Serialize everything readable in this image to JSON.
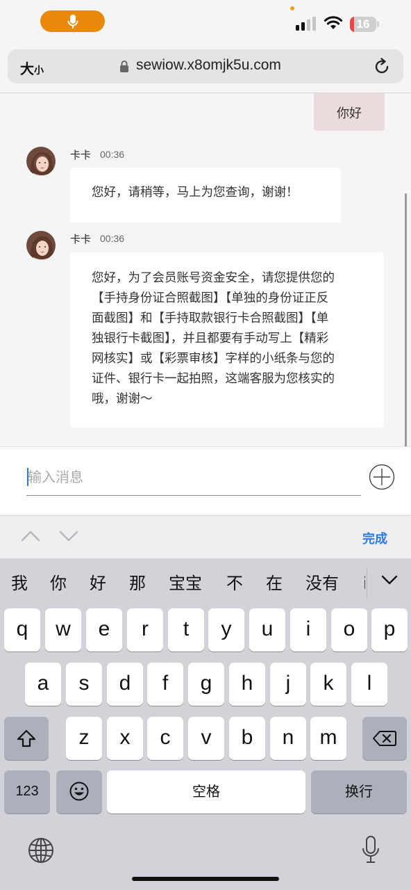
{
  "status_bar": {
    "battery_level": "16",
    "battery_fraction": 0.16,
    "icons": [
      "mic-icon",
      "signal-icon",
      "wifi-icon",
      "battery-icon"
    ],
    "colors": {
      "mic_pill": "#e8890c",
      "battery_fill": "#e8484a"
    }
  },
  "browser": {
    "text_size_label_big": "大",
    "text_size_label_small": "小",
    "url": "sewiow.x8omjk5u.com",
    "icons": [
      "lock-icon",
      "reload-icon"
    ]
  },
  "chat": {
    "my_message": "你好",
    "messages": [
      {
        "sender": "卡卡",
        "time": "00:36",
        "text": "您好，请稍等，马上为您查询，谢谢！"
      },
      {
        "sender": "卡卡",
        "time": "00:36",
        "lines": [
          "您好，为了会员账号资金安全，请您提供您的",
          "【手持身份证合照截图】【单独的身份证正反",
          "面截图】和【手持取款银行卡合照截图】【单",
          "独银行卡截图】，并且都要有手动写上【精彩",
          "网核实】或【彩票审核】字样的小纸条与您的",
          "证件、银行卡一起拍照，这端客服为您核实的",
          "哦，谢谢～"
        ]
      }
    ]
  },
  "composer": {
    "placeholder": "输入消息",
    "icons": [
      "plus-icon"
    ]
  },
  "accessory_bar": {
    "done_label": "完成",
    "icons": [
      "chevron-up-icon",
      "chevron-down-icon"
    ]
  },
  "keyboard": {
    "candidates": [
      "我",
      "你",
      "好",
      "那",
      "宝宝",
      "不",
      "在",
      "没有",
      "i"
    ],
    "row1": [
      "q",
      "w",
      "e",
      "r",
      "t",
      "y",
      "u",
      "i",
      "o",
      "p"
    ],
    "row2": [
      "a",
      "s",
      "d",
      "f",
      "g",
      "h",
      "j",
      "k",
      "l"
    ],
    "row3": [
      "z",
      "x",
      "c",
      "v",
      "b",
      "n",
      "m"
    ],
    "numbers_key": "123",
    "space_key": "空格",
    "return_key": "换行",
    "icons": [
      "shift-icon",
      "delete-icon",
      "emoji-icon",
      "globe-icon",
      "dictation-mic-icon",
      "candidate-expand-icon"
    ]
  }
}
